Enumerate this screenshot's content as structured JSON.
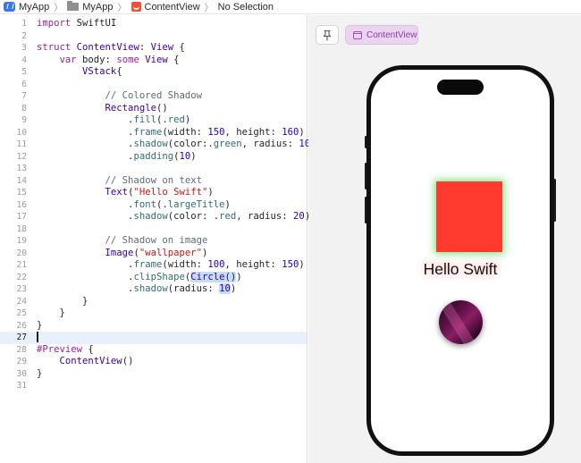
{
  "breadcrumb": {
    "project": "MyApp",
    "folder": "MyApp",
    "file": "ContentView",
    "selection": "No Selection"
  },
  "editor": {
    "line_numbers": [
      "1",
      "2",
      "3",
      "4",
      "5",
      "6",
      "7",
      "8",
      "9",
      "10",
      "11",
      "12",
      "13",
      "14",
      "15",
      "16",
      "17",
      "18",
      "19",
      "20",
      "21",
      "22",
      "23",
      "24",
      "25",
      "26",
      "27",
      "28",
      "29",
      "30",
      "31"
    ],
    "current_line": "27"
  },
  "preview": {
    "pin_icon": "pin-icon",
    "contentview_label": "ContentView",
    "hello_text": "Hello Swift"
  },
  "colors": {
    "rect_fill": "#ff3b30",
    "rect_shadow": "green",
    "accent": "#8d3ea6"
  }
}
